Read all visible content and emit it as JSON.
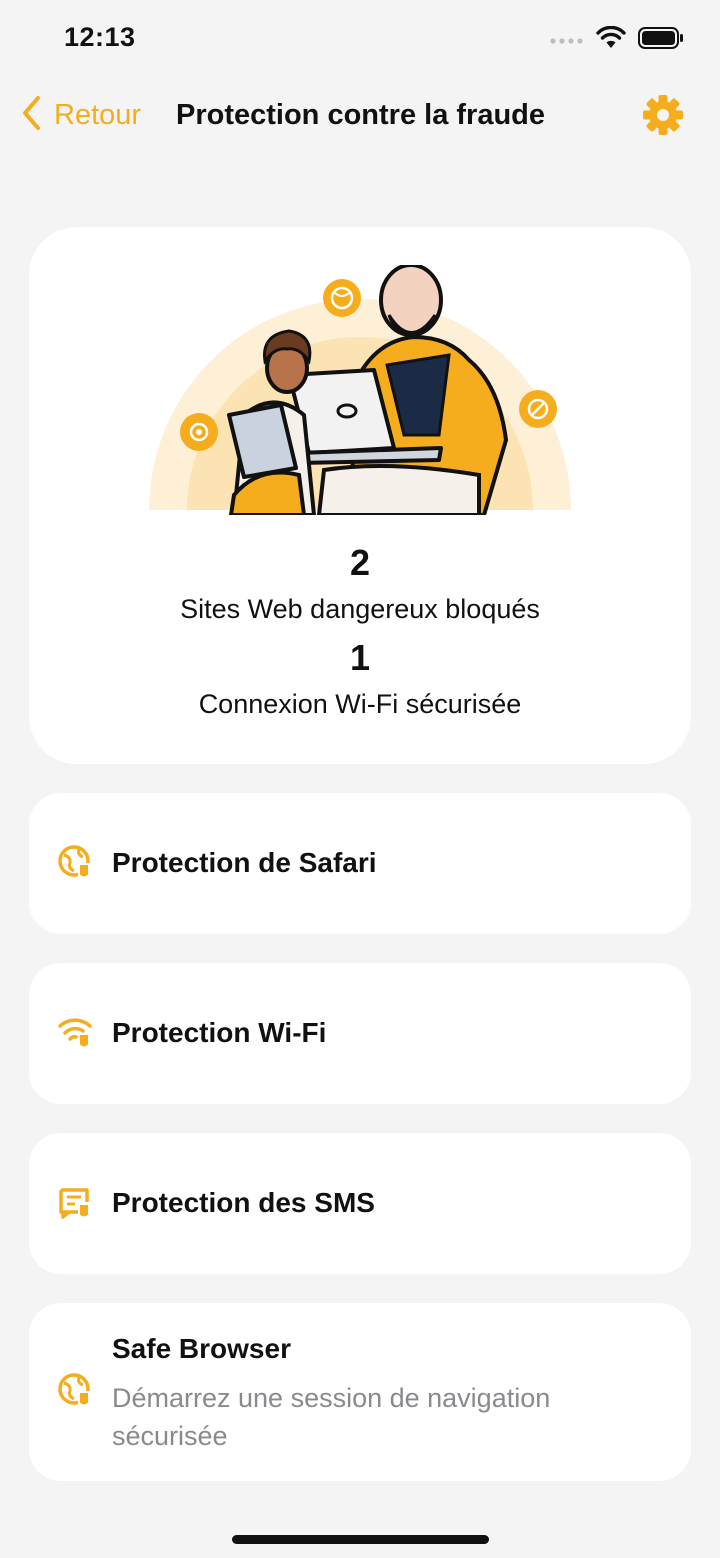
{
  "status": {
    "time": "12:13"
  },
  "nav": {
    "back_label": "Retour",
    "title": "Protection contre la fraude"
  },
  "summary": {
    "stats": [
      {
        "value": "2",
        "label": "Sites Web dangereux bloqués"
      },
      {
        "value": "1",
        "label": "Connexion Wi-Fi sécurisée"
      }
    ]
  },
  "features": [
    {
      "title": "Protection de Safari",
      "icon": "globe-shield-icon"
    },
    {
      "title": "Protection Wi-Fi",
      "icon": "wifi-shield-icon"
    },
    {
      "title": "Protection des SMS",
      "icon": "message-shield-icon"
    },
    {
      "title": "Safe Browser",
      "subtitle": "Démarrez une session de navigation sécurisée",
      "icon": "globe-shield-icon"
    }
  ],
  "colors": {
    "accent": "#f5ad1d",
    "background": "#f4f4f4",
    "card": "#ffffff"
  }
}
